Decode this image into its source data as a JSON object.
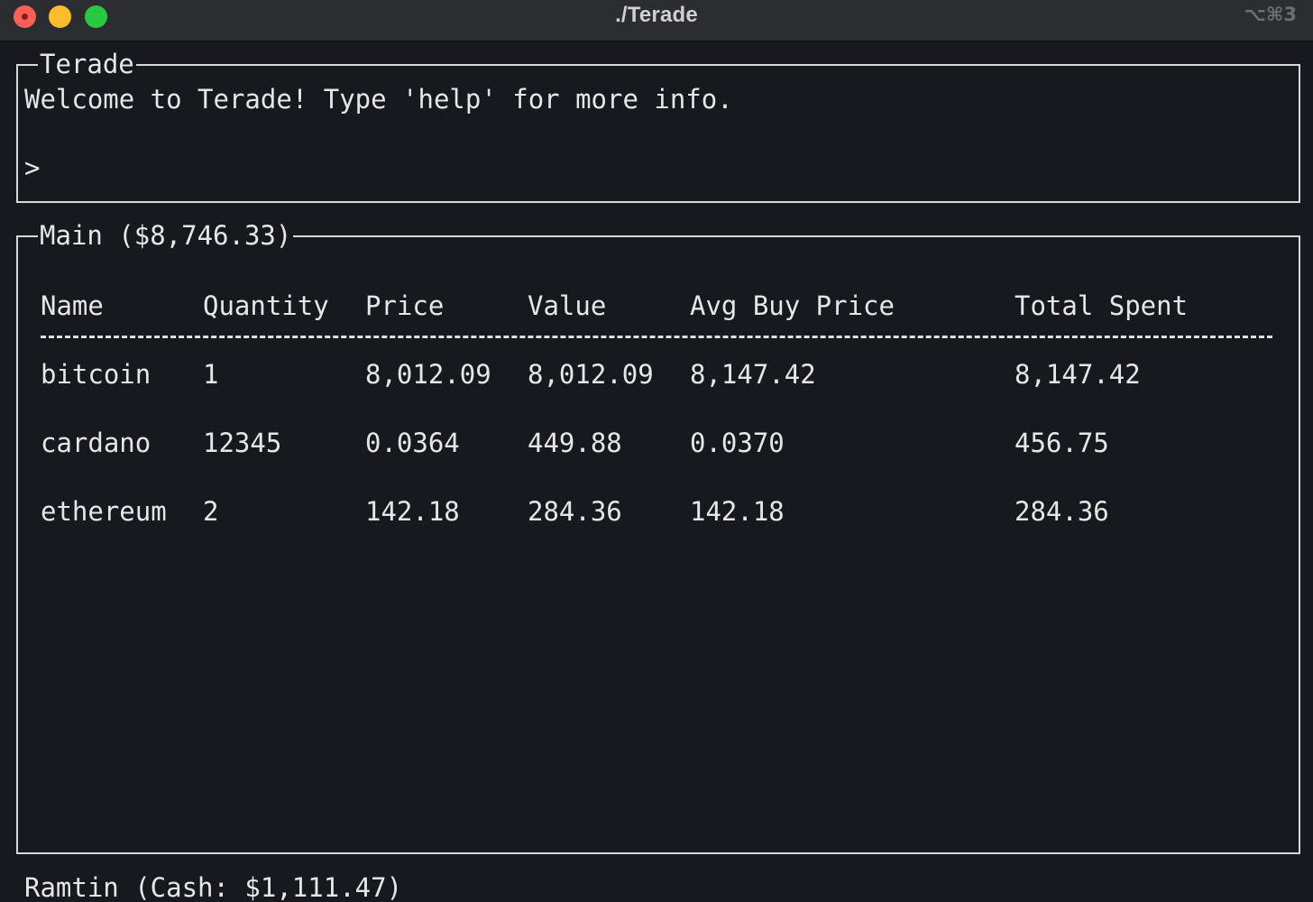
{
  "window": {
    "title": "./Terade",
    "shortcut": "⌥⌘3"
  },
  "terade_box": {
    "title": "Terade",
    "welcome": "Welcome to Terade! Type 'help' for more info.",
    "prompt": ">"
  },
  "main_box": {
    "title": "Main ($8,746.33)",
    "columns": [
      "Name",
      "Quantity",
      "Price",
      "Value",
      "Avg Buy Price",
      "Total Spent"
    ],
    "rows": [
      [
        "bitcoin",
        "1",
        "8,012.09",
        "8,012.09",
        "8,147.42",
        "8,147.42"
      ],
      [
        "cardano",
        "12345",
        "0.0364",
        "449.88",
        "0.0370",
        "456.75"
      ],
      [
        "ethereum",
        "2",
        "142.18",
        "284.36",
        "142.18",
        "284.36"
      ]
    ]
  },
  "status": {
    "text": "Ramtin (Cash: $1,111.47)"
  }
}
